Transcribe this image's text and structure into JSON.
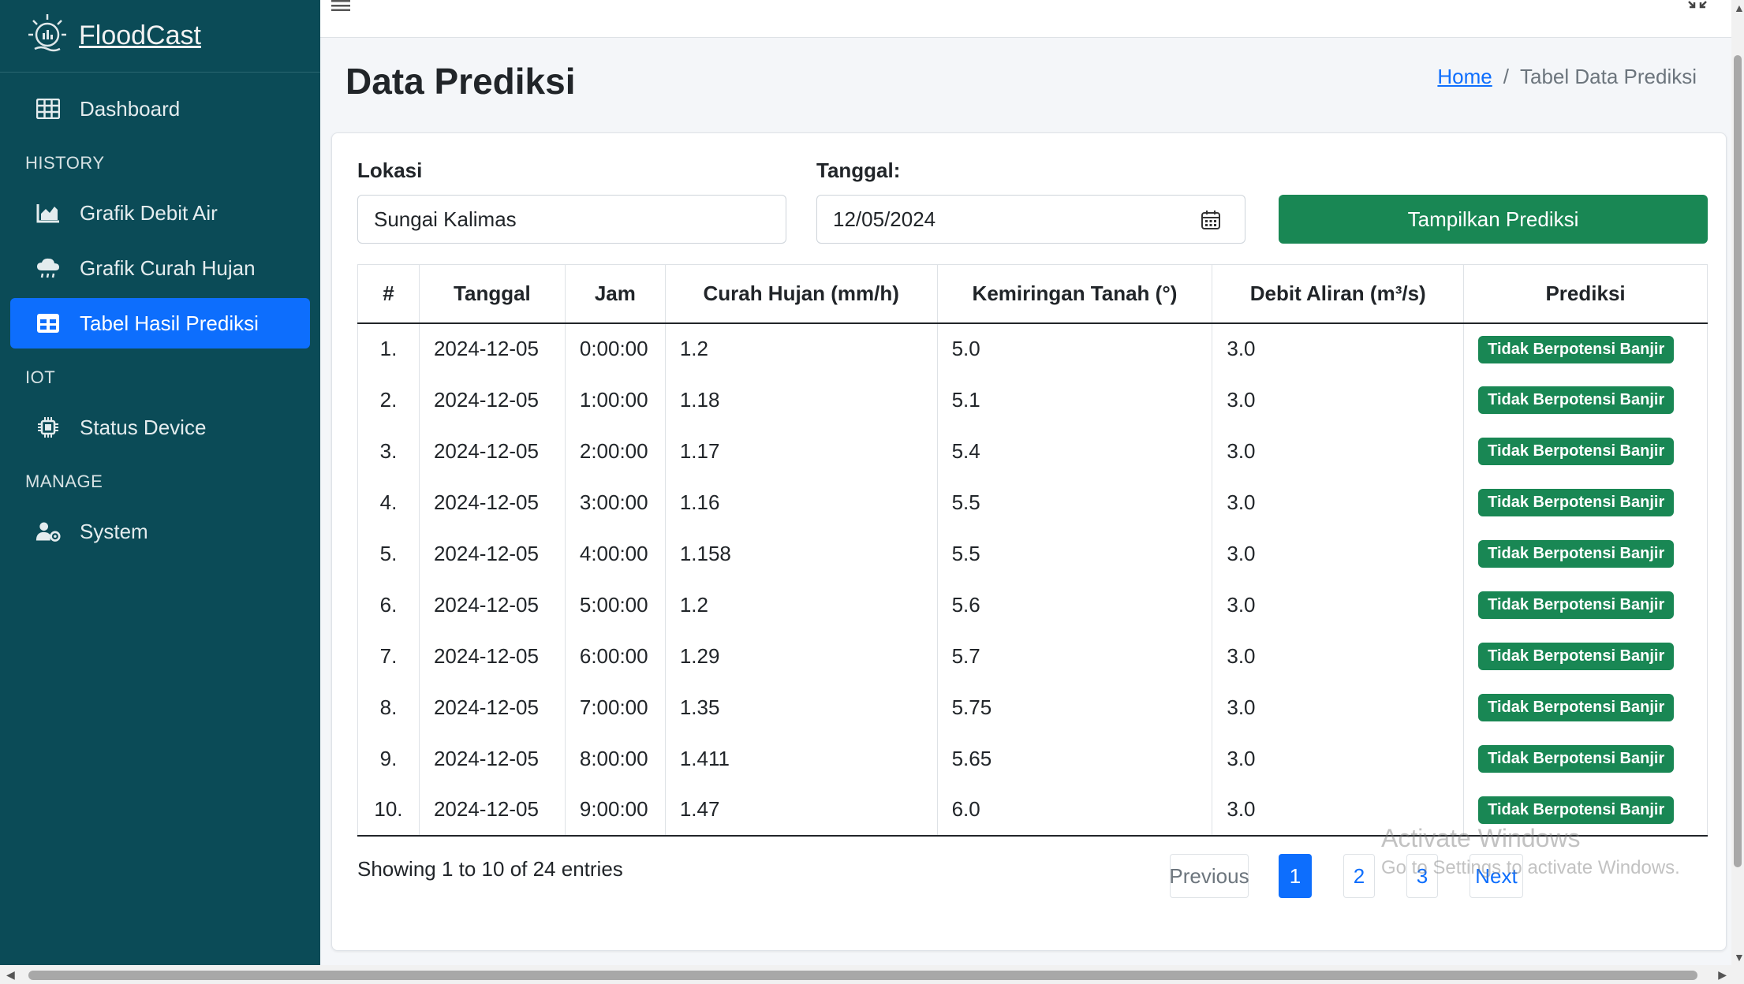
{
  "brand": {
    "name": "FloodCast"
  },
  "sidebar": {
    "dashboard": "Dashboard",
    "history_header": "HISTORY",
    "grafik_debit": "Grafik Debit Air",
    "grafik_curah": "Grafik Curah Hujan",
    "tabel_prediksi": "Tabel Hasil Prediksi",
    "iot_header": "IOT",
    "status_device": "Status Device",
    "manage_header": "MANAGE",
    "system": "System"
  },
  "page": {
    "title": "Data Prediksi",
    "breadcrumb_home": "Home",
    "breadcrumb_sep": "/",
    "breadcrumb_current": "Tabel Data Prediksi"
  },
  "form": {
    "lokasi_label": "Lokasi",
    "lokasi_value": "Sungai Kalimas",
    "tanggal_label": "Tanggal:",
    "tanggal_value": "12/05/2024",
    "button": "Tampilkan Prediksi"
  },
  "table": {
    "headers": [
      "#",
      "Tanggal",
      "Jam",
      "Curah Hujan (mm/h)",
      "Kemiringan Tanah (°)",
      "Debit Aliran (m³/s)",
      "Prediksi"
    ],
    "rows": [
      [
        "1.",
        "2024-12-05",
        "0:00:00",
        "1.2",
        "5.0",
        "3.0",
        "Tidak Berpotensi Banjir"
      ],
      [
        "2.",
        "2024-12-05",
        "1:00:00",
        "1.18",
        "5.1",
        "3.0",
        "Tidak Berpotensi Banjir"
      ],
      [
        "3.",
        "2024-12-05",
        "2:00:00",
        "1.17",
        "5.4",
        "3.0",
        "Tidak Berpotensi Banjir"
      ],
      [
        "4.",
        "2024-12-05",
        "3:00:00",
        "1.16",
        "5.5",
        "3.0",
        "Tidak Berpotensi Banjir"
      ],
      [
        "5.",
        "2024-12-05",
        "4:00:00",
        "1.158",
        "5.5",
        "3.0",
        "Tidak Berpotensi Banjir"
      ],
      [
        "6.",
        "2024-12-05",
        "5:00:00",
        "1.2",
        "5.6",
        "3.0",
        "Tidak Berpotensi Banjir"
      ],
      [
        "7.",
        "2024-12-05",
        "6:00:00",
        "1.29",
        "5.7",
        "3.0",
        "Tidak Berpotensi Banjir"
      ],
      [
        "8.",
        "2024-12-05",
        "7:00:00",
        "1.35",
        "5.75",
        "3.0",
        "Tidak Berpotensi Banjir"
      ],
      [
        "9.",
        "2024-12-05",
        "8:00:00",
        "1.411",
        "5.65",
        "3.0",
        "Tidak Berpotensi Banjir"
      ],
      [
        "10.",
        "2024-12-05",
        "9:00:00",
        "1.47",
        "6.0",
        "3.0",
        "Tidak Berpotensi Banjir"
      ]
    ]
  },
  "pagination": {
    "info": "Showing 1 to 10 of 24 entries",
    "previous": "Previous",
    "pages": [
      "1",
      "2",
      "3"
    ],
    "next": "Next"
  },
  "watermark": {
    "title": "Activate Windows",
    "subtitle": "Go to Settings to activate Windows."
  },
  "colors": {
    "sidebar": "#0b4b57",
    "accent": "#0d6efd",
    "success": "#198754"
  }
}
